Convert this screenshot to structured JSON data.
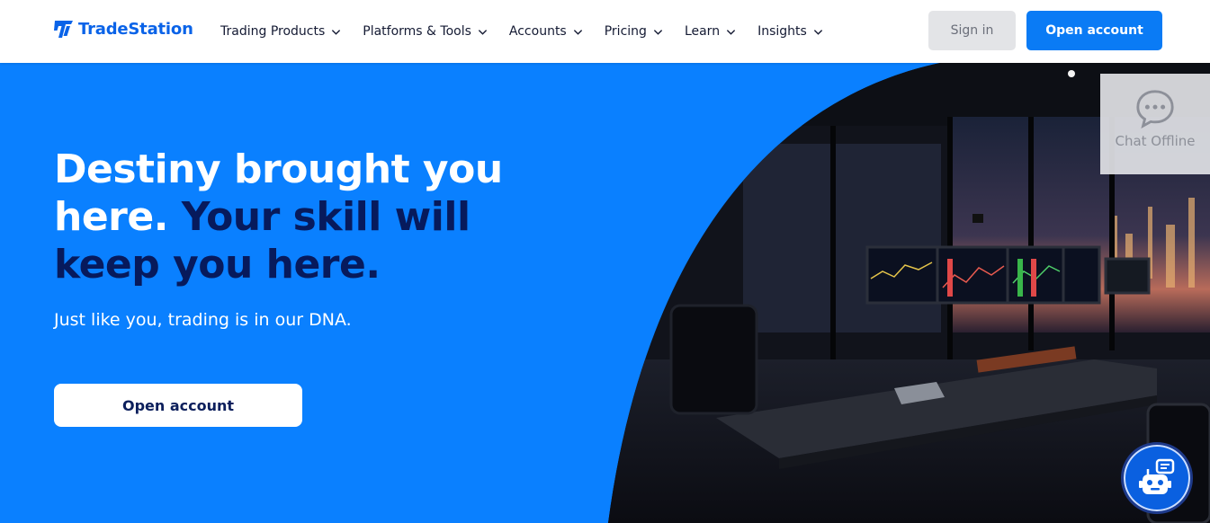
{
  "brand": {
    "name": "TradeStation",
    "color": "#0a63e8"
  },
  "nav": {
    "items": [
      {
        "label": "Trading Products"
      },
      {
        "label": "Platforms & Tools"
      },
      {
        "label": "Accounts"
      },
      {
        "label": "Pricing"
      },
      {
        "label": "Learn"
      },
      {
        "label": "Insights"
      }
    ],
    "sign_in_label": "Sign in",
    "open_account_label": "Open account"
  },
  "hero": {
    "headline_part1": "Destiny brought you here. ",
    "headline_part2": "Your skill will keep you here.",
    "subline": "Just like you, trading is in our DNA.",
    "cta_label": "Open account",
    "background_color": "#0a80ff",
    "accent_dark": "#071a5c"
  },
  "chat": {
    "status_label": "Chat Offline"
  },
  "icons": [
    "tradestation-logo-icon",
    "chevron-down-icon",
    "chat-bubble-icon",
    "chatbot-icon"
  ]
}
